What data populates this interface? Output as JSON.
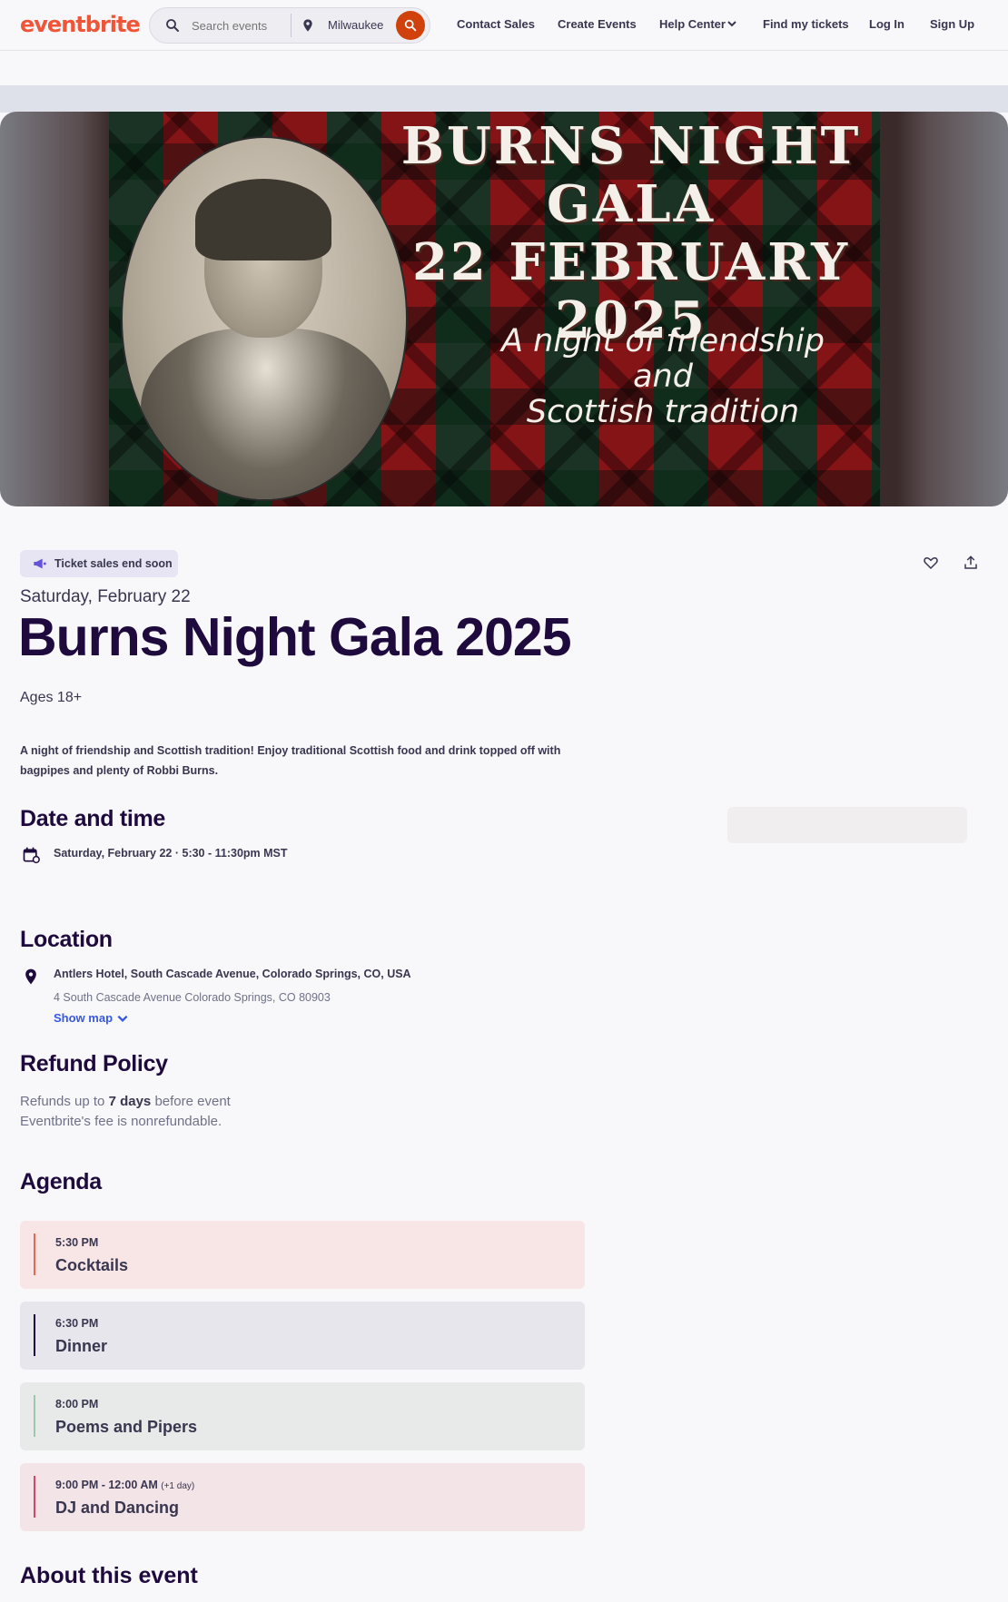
{
  "header": {
    "logo": "eventbrite",
    "search_placeholder": "Search events",
    "location": "Milwaukee",
    "nav": {
      "contact_sales": "Contact Sales",
      "create_events": "Create Events",
      "help_center": "Help Center",
      "find_tickets": "Find my tickets",
      "log_in": "Log In",
      "sign_up": "Sign Up"
    }
  },
  "hero": {
    "title_line1": "BURNS NIGHT GALA",
    "title_line2": "22 FEBRUARY 2025",
    "sub_line1": "A night of friendship",
    "sub_line2": "and",
    "sub_line3": "Scottish tradition"
  },
  "event": {
    "badge": "Ticket sales end soon",
    "date_sub": "Saturday, February 22",
    "title": "Burns Night Gala 2025",
    "ages": "Ages 18+",
    "summary": "A night of friendship and Scottish tradition! Enjoy traditional Scottish food and drink topped off with bagpipes and plenty of Robbi Burns."
  },
  "date_time": {
    "heading": "Date and time",
    "value": "Saturday, February 22 · 5:30 - 11:30pm MST"
  },
  "location": {
    "heading": "Location",
    "venue": "Antlers Hotel, South Cascade Avenue, Colorado Springs, CO, USA",
    "address": "4 South Cascade Avenue Colorado Springs, CO 80903",
    "show_map": "Show map"
  },
  "refund": {
    "heading": "Refund Policy",
    "line1_prefix": "Refunds up to",
    "line1_bold": "7 days",
    "line1_suffix": "before event",
    "line2": "Eventbrite's fee is nonrefundable."
  },
  "agenda": {
    "heading": "Agenda",
    "items": [
      {
        "time": "5:30 PM",
        "extra": "",
        "name": "Cocktails",
        "bg": "#f7e6e5",
        "bar": "#e8694f"
      },
      {
        "time": "6:30 PM",
        "extra": "",
        "name": "Dinner",
        "bg": "#e6e6ec",
        "bar": "#1e0a3c"
      },
      {
        "time": "8:00 PM",
        "extra": "",
        "name": "Poems and Pipers",
        "bg": "#e8eae9",
        "bar": "#9fc7ad"
      },
      {
        "time": "9:00 PM - 12:00 AM",
        "extra": "(+1 day)",
        "name": "DJ and Dancing",
        "bg": "#f3e4e8",
        "bar": "#d6456a"
      }
    ]
  },
  "about": {
    "heading": "About this event"
  },
  "colors": {
    "brand": "#f05537",
    "search_button": "#d1410c",
    "link": "#3659e3",
    "text_dark": "#1e0a3c"
  }
}
